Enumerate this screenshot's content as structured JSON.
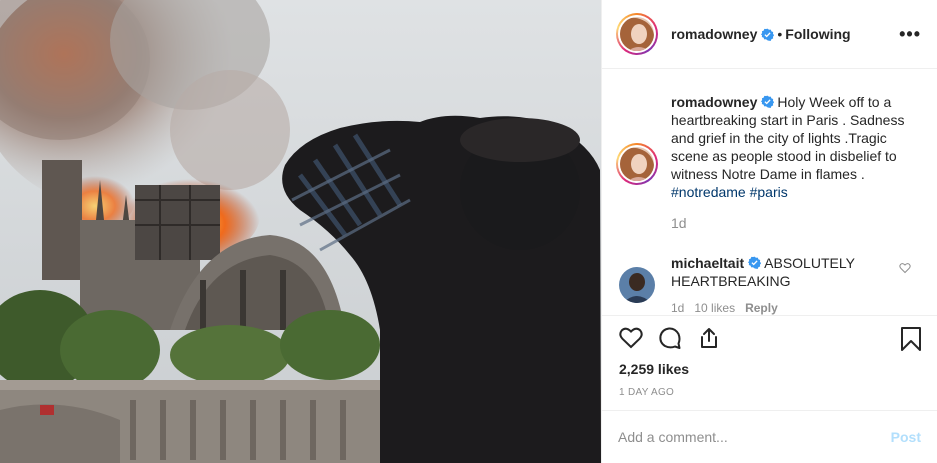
{
  "header": {
    "username": "romadowney",
    "separator": "•",
    "follow_status": "Following",
    "more_label": "•••"
  },
  "caption": {
    "username": "romadowney",
    "text": "Holy Week off to a heartbreaking start in Paris . Sadness and grief in the city of lights .Tragic scene as people stood in disbelief to witness Notre Dame in flames .",
    "hashtags": [
      "#notredame",
      "#paris"
    ],
    "time": "1d"
  },
  "comments": [
    {
      "username": "michaeltait",
      "text": "ABSOLUTELY HEARTBREAKING",
      "time": "1d",
      "likes": "10 likes",
      "reply": "Reply"
    }
  ],
  "actions": {
    "likes": "2,259 likes",
    "posted_ago": "1 DAY AGO"
  },
  "add_comment": {
    "placeholder": "Add a comment...",
    "post_label": "Post"
  },
  "colors": {
    "verified": "#3897f0",
    "hashtag": "#00376b",
    "post_button_disabled": "#b2dffc",
    "muted": "#8e8e8e"
  },
  "icons": [
    "verified-badge-icon",
    "more-options-icon",
    "heart-icon",
    "comment-icon",
    "share-icon",
    "bookmark-icon",
    "comment-heart-icon"
  ]
}
